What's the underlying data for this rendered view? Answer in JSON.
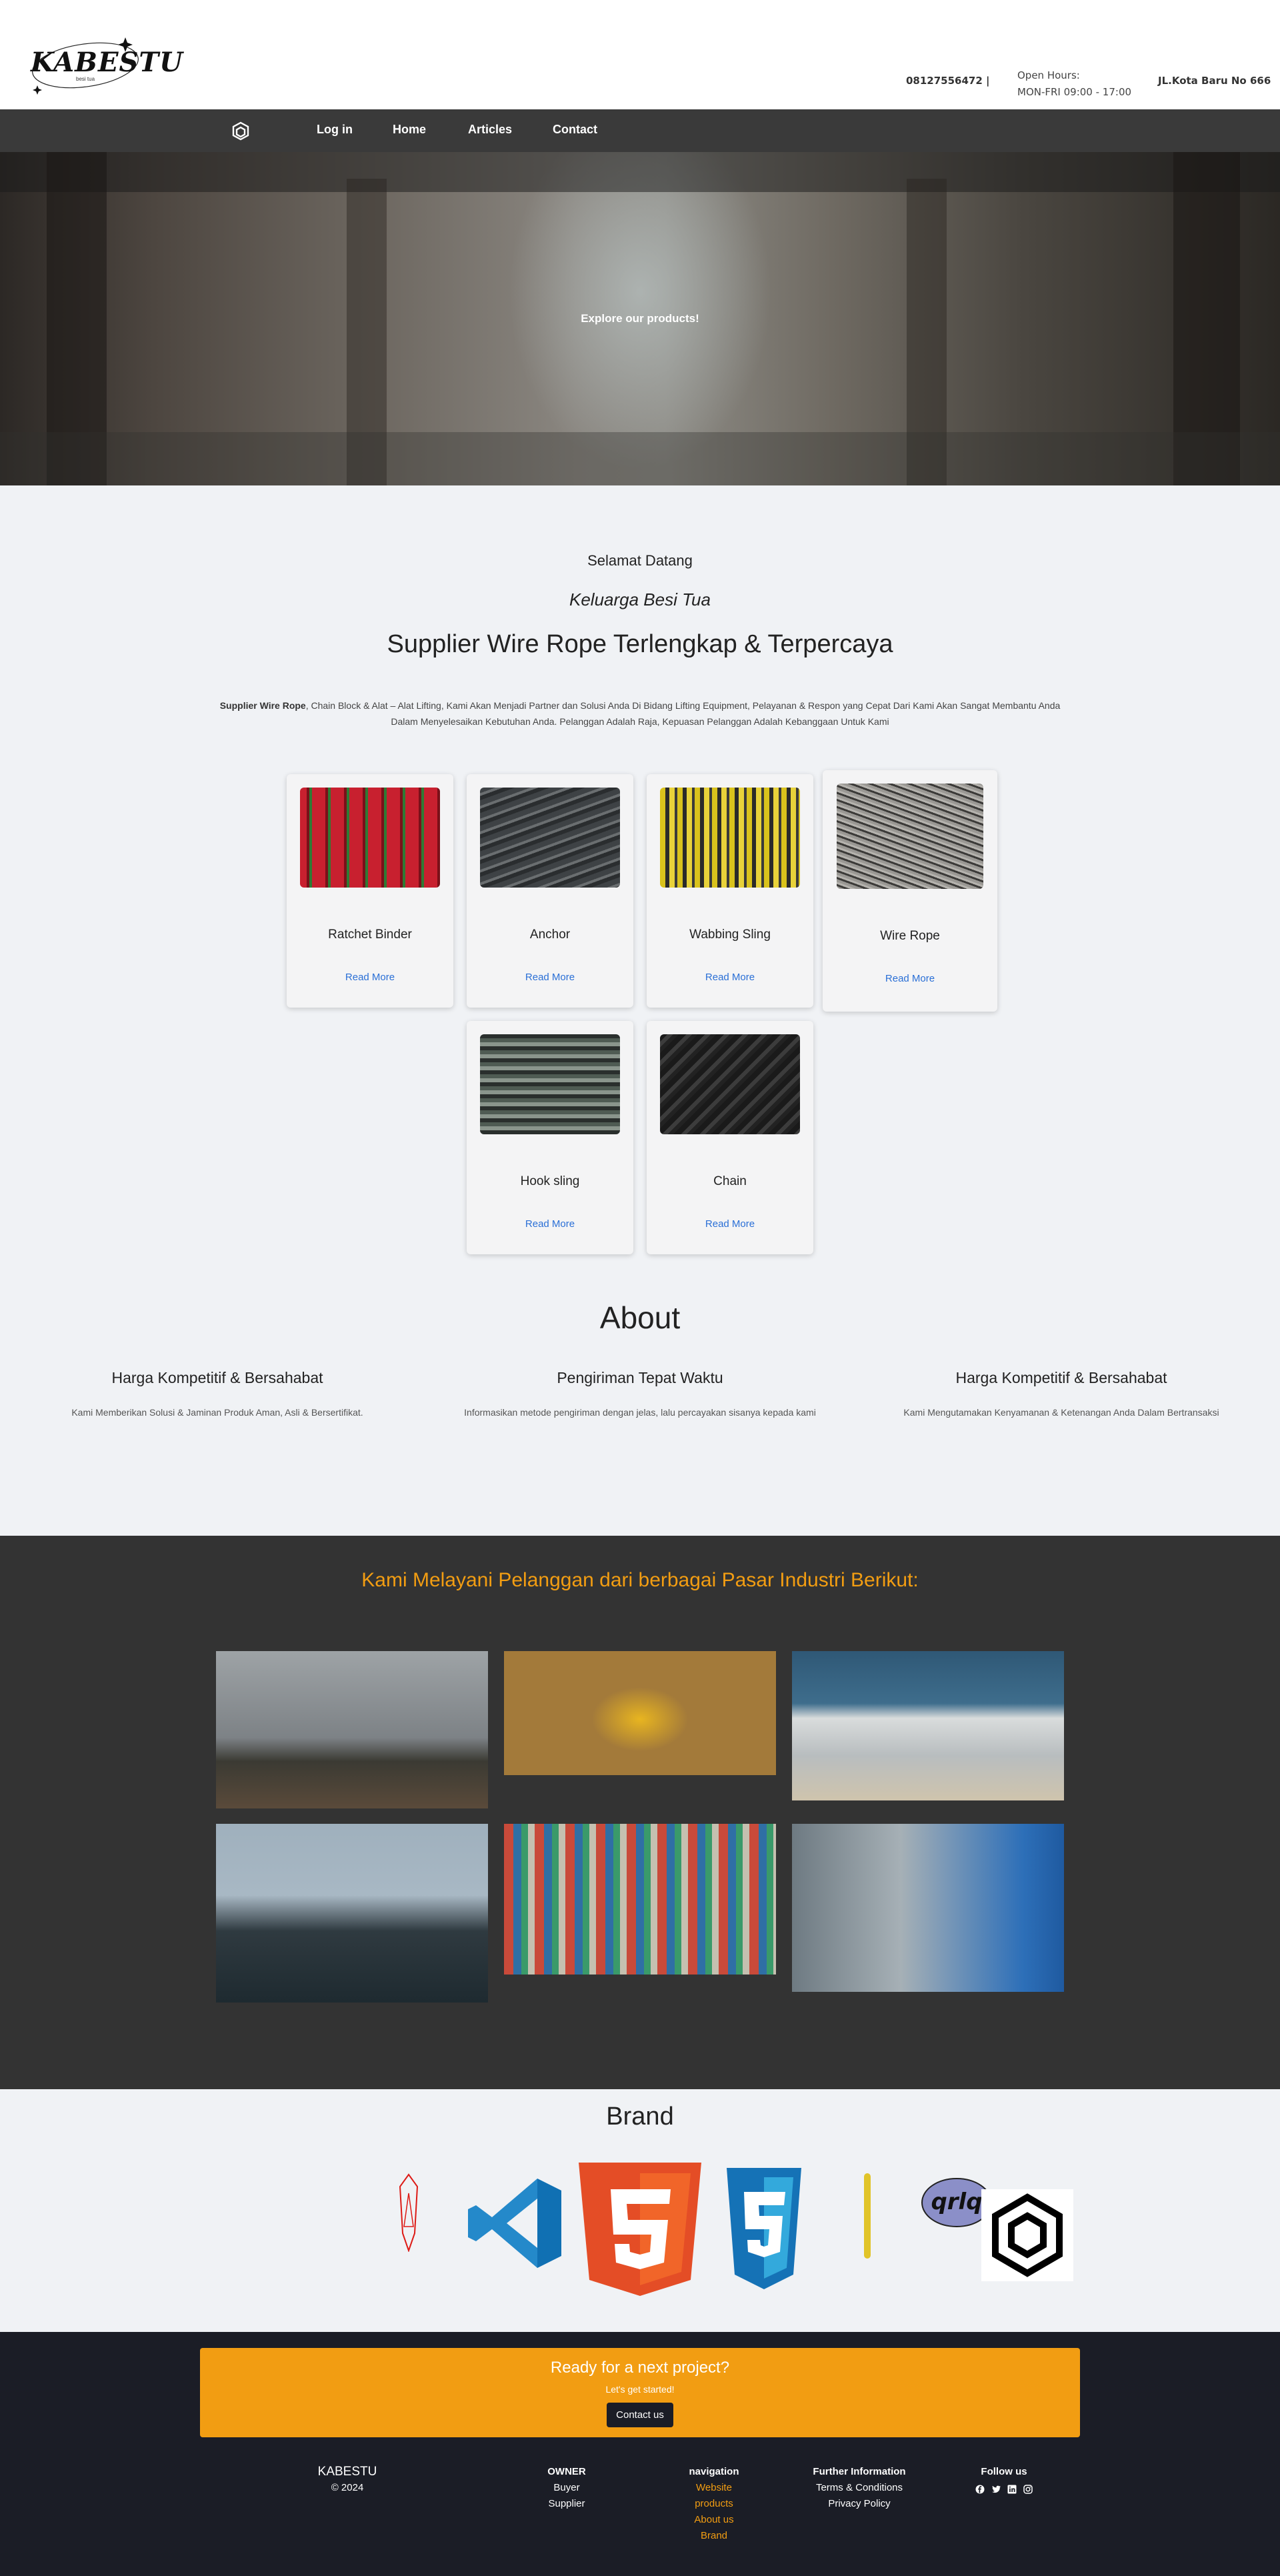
{
  "header": {
    "logo_text": "KABESTU",
    "logo_sub": "besi tua",
    "phone": "08127556472 |",
    "hours_label": "Open Hours:",
    "hours_value": "MON-FRI 09:00 - 17:00",
    "address": "JL.Kota Baru No 666"
  },
  "nav": {
    "items": [
      {
        "label": "Log in"
      },
      {
        "label": "Home"
      },
      {
        "label": "Articles"
      },
      {
        "label": "Contact"
      }
    ],
    "logo_icon": "openai-logo-icon"
  },
  "hero": {
    "text": "Explore our products!"
  },
  "welcome": {
    "line1": "Selamat Datang",
    "line2": "Keluarga Besi Tua",
    "line3": "Supplier Wire Rope Terlengkap & Terpercaya",
    "desc_bold": "Supplier Wire Rope",
    "desc_rest": ", Chain Block & Alat – Alat Lifting, Kami Akan Menjadi Partner dan Solusi Anda Di Bidang Lifting Equipment, Pelayanan & Respon yang Cepat Dari Kami Akan Sangat Membantu Anda Dalam Menyelesaikan Kebutuhan Anda. Pelanggan Adalah Raja, Kepuasan Pelanggan Adalah Kebanggaan Untuk Kami"
  },
  "products": [
    {
      "name": "Ratchet Binder",
      "more": "Read More",
      "color": "#c8202f"
    },
    {
      "name": "Anchor",
      "more": "Read More",
      "color": "#55595c"
    },
    {
      "name": "Wabbing Sling",
      "more": "Read More",
      "color": "#d9c21c"
    },
    {
      "name": "Wire Rope",
      "more": "Read More",
      "color": "#8a8884"
    },
    {
      "name": "Hook sling",
      "more": "Read More",
      "color": "#6d7770"
    },
    {
      "name": "Chain",
      "more": "Read More",
      "color": "#2b2b2b"
    }
  ],
  "about": {
    "title": "About",
    "cols": [
      {
        "title": "Harga Kompetitif & Bersahabat",
        "text": "Kami Memberikan Solusi & Jaminan Produk Aman, Asli & Bersertifikat."
      },
      {
        "title": "Pengiriman Tepat Waktu",
        "text": "Informasikan metode pengiriman dengan jelas, lalu percayakan sisanya kepada kami"
      },
      {
        "title": "Harga Kompetitif & Bersahabat",
        "text": "Kami Mengutamakan Kenyamanan & Ketenangan Anda Dalam Bertransaksi"
      }
    ]
  },
  "industries": {
    "title": "Kami Melayani Pelanggan dari berbagai Pasar Industri Berikut:"
  },
  "brand": {
    "title": "Brand",
    "logos": [
      "angular-icon",
      "vscode-icon",
      "html5-icon",
      "css3-icon",
      "qrlq-icon",
      "openai-icon"
    ]
  },
  "footer": {
    "cta_title": "Ready for a next project?",
    "cta_sub": "Let's get started!",
    "cta_button": "Contact us",
    "company": "KABESTU",
    "copyright": "© 2024",
    "owner_head": "OWNER",
    "owner_items": [
      "Buyer",
      "Supplier"
    ],
    "nav_head": "navigation",
    "nav_items": [
      "Website",
      "products",
      "About us",
      "Brand"
    ],
    "further_head": "Further Information",
    "further_items": [
      "Terms & Conditions",
      "Privacy Policy"
    ],
    "follow_head": "Follow us",
    "accent": "#f29d12"
  }
}
